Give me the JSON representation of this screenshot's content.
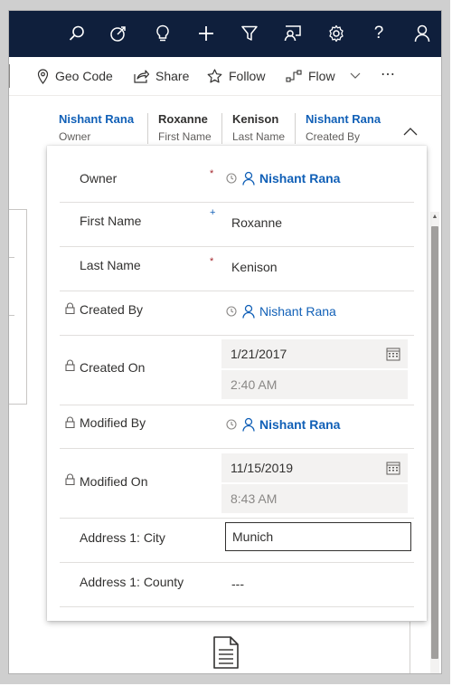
{
  "topbar": {
    "icons": [
      "search-icon",
      "assistant-icon",
      "lightbulb-icon",
      "add-icon",
      "filter-icon",
      "share-records-icon",
      "settings-icon",
      "help-icon",
      "user-icon"
    ],
    "help_glyph": "?"
  },
  "commands": {
    "geo_code": "Geo Code",
    "share": "Share",
    "follow": "Follow",
    "flow": "Flow",
    "more": "⋯"
  },
  "header_fields": [
    {
      "value": "Nishant Rana",
      "label": "Owner"
    },
    {
      "value": "Roxanne",
      "label": "First Name"
    },
    {
      "value": "Kenison",
      "label": "Last Name"
    },
    {
      "value": "Nishant Rana",
      "label": "Created By"
    }
  ],
  "flyout": {
    "owner": {
      "label": "Owner",
      "required": "*",
      "value": "Nishant Rana"
    },
    "first_name": {
      "label": "First Name",
      "recommended": "+",
      "value": "Roxanne"
    },
    "last_name": {
      "label": "Last Name",
      "required": "*",
      "value": "Kenison"
    },
    "created_by": {
      "label": "Created By",
      "value": "Nishant Rana"
    },
    "created_on": {
      "label": "Created On",
      "date": "1/21/2017",
      "time": "2:40 AM"
    },
    "modified_by": {
      "label": "Modified By",
      "value": "Nishant Rana"
    },
    "modified_on": {
      "label": "Modified On",
      "date": "11/15/2019",
      "time": "8:43 AM"
    },
    "city": {
      "label": "Address 1: City",
      "value": "Munich"
    },
    "county": {
      "label": "Address 1: County",
      "value": "---"
    }
  },
  "colors": {
    "topbar": "#0f1f3c",
    "link": "#1160b7",
    "required": "#a4262c"
  }
}
